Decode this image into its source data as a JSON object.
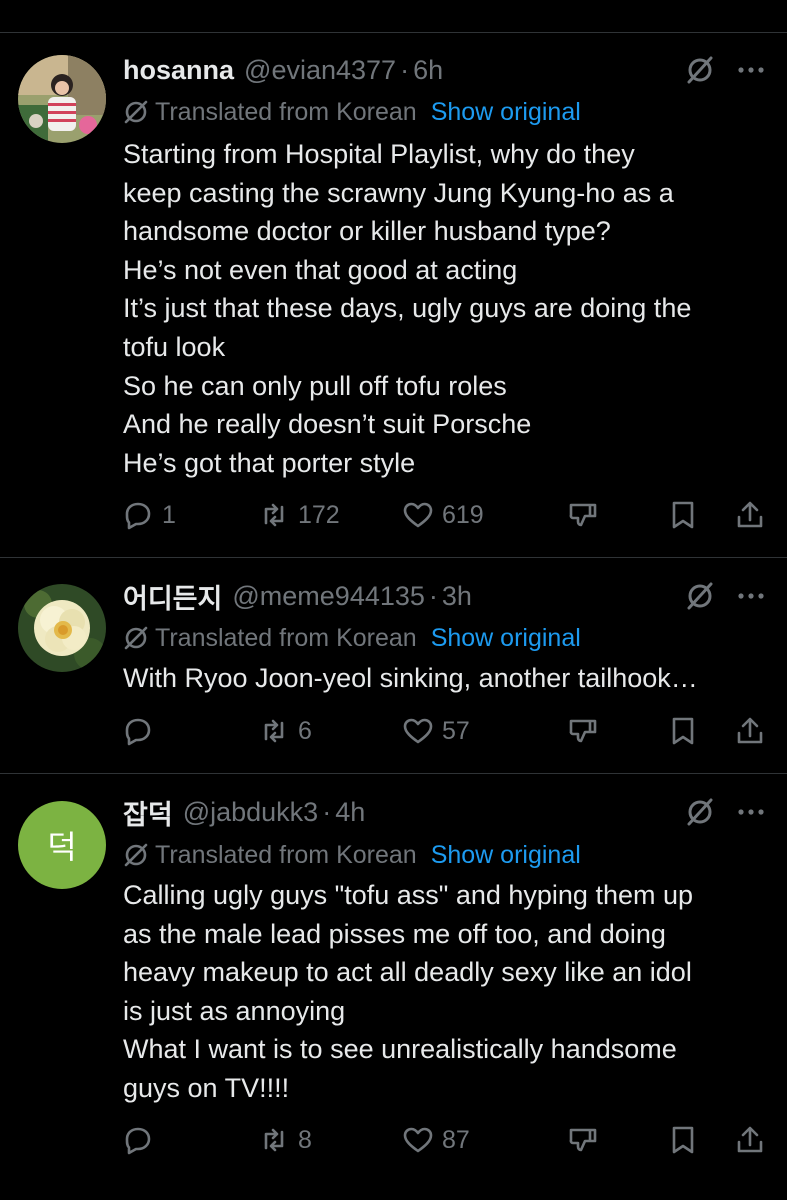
{
  "tweets": [
    {
      "name": "hosanna",
      "handle": "@evian4377",
      "time": "6h",
      "translated_label": "Translated from Korean",
      "show_original": "Show original",
      "lines": [
        "Starting from Hospital Playlist, why do they",
        "keep casting the scrawny Jung Kyung-ho as a",
        "handsome doctor or killer husband type?",
        "He’s not even that good at acting",
        "It’s just that these days, ugly guys are doing the",
        "tofu look",
        "So he can only pull off tofu roles",
        "And he really doesn’t suit Porsche",
        "He’s got that porter style"
      ],
      "replies": "1",
      "reposts": "172",
      "likes": "619"
    },
    {
      "name": "어디든지",
      "handle": "@meme944135",
      "time": "3h",
      "translated_label": "Translated from Korean",
      "show_original": "Show original",
      "lines": [
        "With Ryoo Joon-yeol sinking, another tailhook…"
      ],
      "replies": "",
      "reposts": "6",
      "likes": "57"
    },
    {
      "name": "잡덕",
      "handle": "@jabdukk3",
      "time": "4h",
      "avatar_letter": "덕",
      "avatar_color": "#7cb342",
      "translated_label": "Translated from Korean",
      "show_original": "Show original",
      "lines": [
        "Calling ugly guys \"tofu ass\" and hyping them up",
        "as the male lead pisses me off too, and doing",
        "heavy makeup to act all deadly sexy like an idol",
        "is just as annoying",
        "What I want is to see unrealistically handsome",
        "guys on TV!!!!"
      ],
      "replies": "",
      "reposts": "8",
      "likes": "87"
    }
  ],
  "colors": {
    "background": "#000000",
    "text": "#e7e9ea",
    "muted": "#71767b",
    "link": "#1d9bf0",
    "divider": "#2f3336"
  },
  "icons": [
    "grok-icon",
    "more-icon",
    "reply-icon",
    "repost-icon",
    "like-icon",
    "dislike-icon",
    "bookmark-icon",
    "share-icon",
    "translate-icon"
  ]
}
